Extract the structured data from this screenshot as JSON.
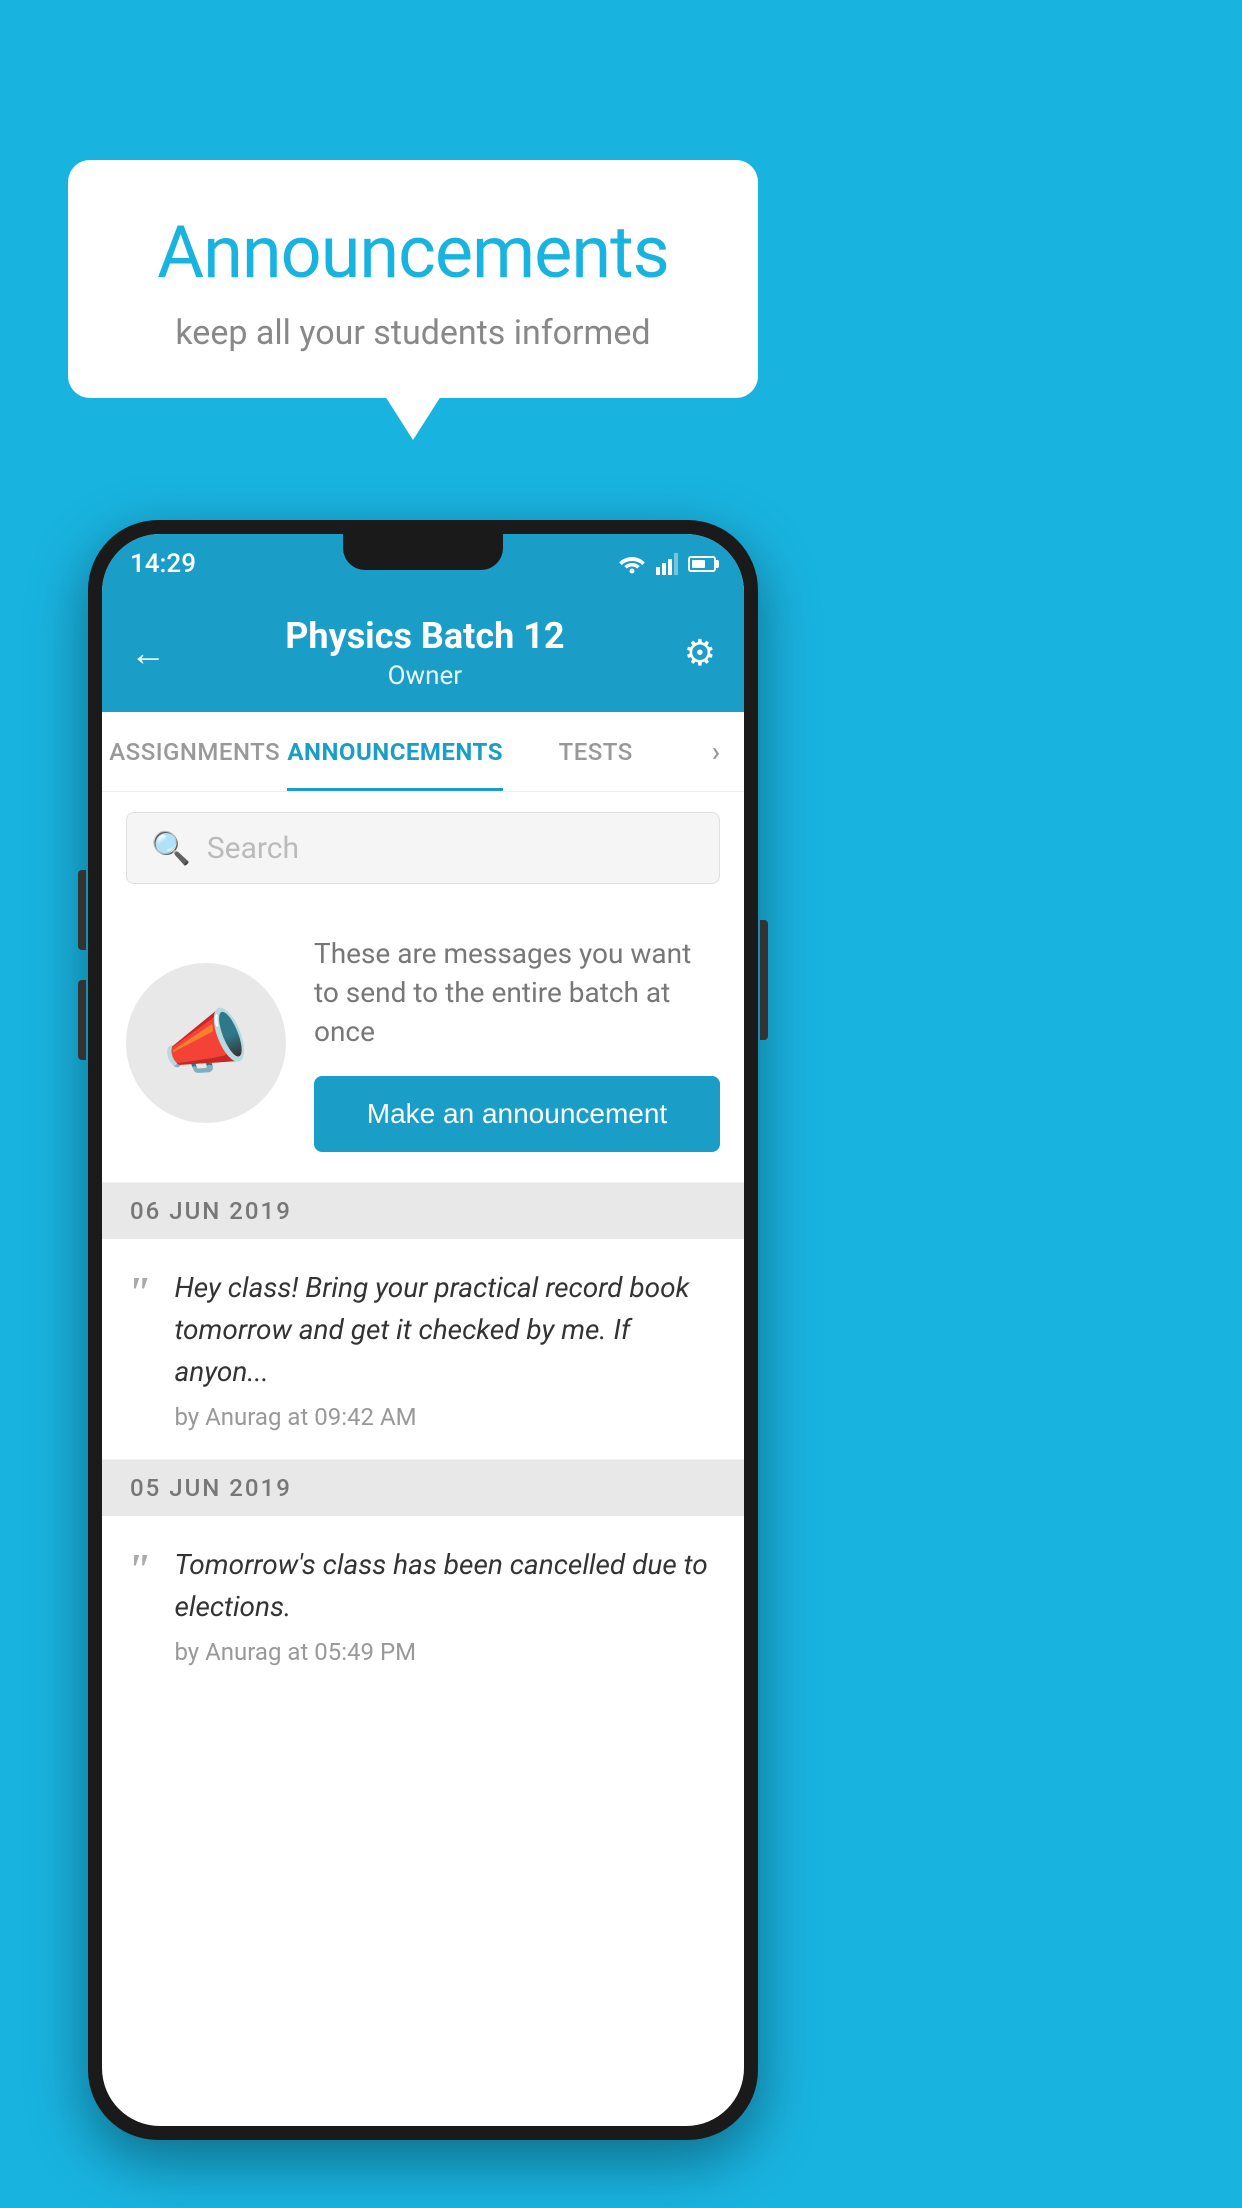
{
  "background_color": "#19b3e0",
  "speech_bubble": {
    "title": "Announcements",
    "subtitle": "keep all your students informed"
  },
  "status_bar": {
    "time": "14:29"
  },
  "app_header": {
    "title": "Physics Batch 12",
    "subtitle": "Owner",
    "back_label": "←",
    "gear_label": "⚙"
  },
  "tabs": [
    {
      "label": "ASSIGNMENTS",
      "active": false
    },
    {
      "label": "ANNOUNCEMENTS",
      "active": true
    },
    {
      "label": "TESTS",
      "active": false
    }
  ],
  "search": {
    "placeholder": "Search"
  },
  "promo": {
    "description": "These are messages you want to send to the entire batch at once",
    "button_label": "Make an announcement"
  },
  "date_groups": [
    {
      "date": "06  JUN  2019",
      "announcements": [
        {
          "text": "Hey class! Bring your practical record book tomorrow and get it checked by me. If anyon...",
          "author": "by Anurag at 09:42 AM"
        }
      ]
    },
    {
      "date": "05  JUN  2019",
      "announcements": [
        {
          "text": "Tomorrow's class has been cancelled due to elections.",
          "author": "by Anurag at 05:49 PM"
        }
      ]
    }
  ]
}
